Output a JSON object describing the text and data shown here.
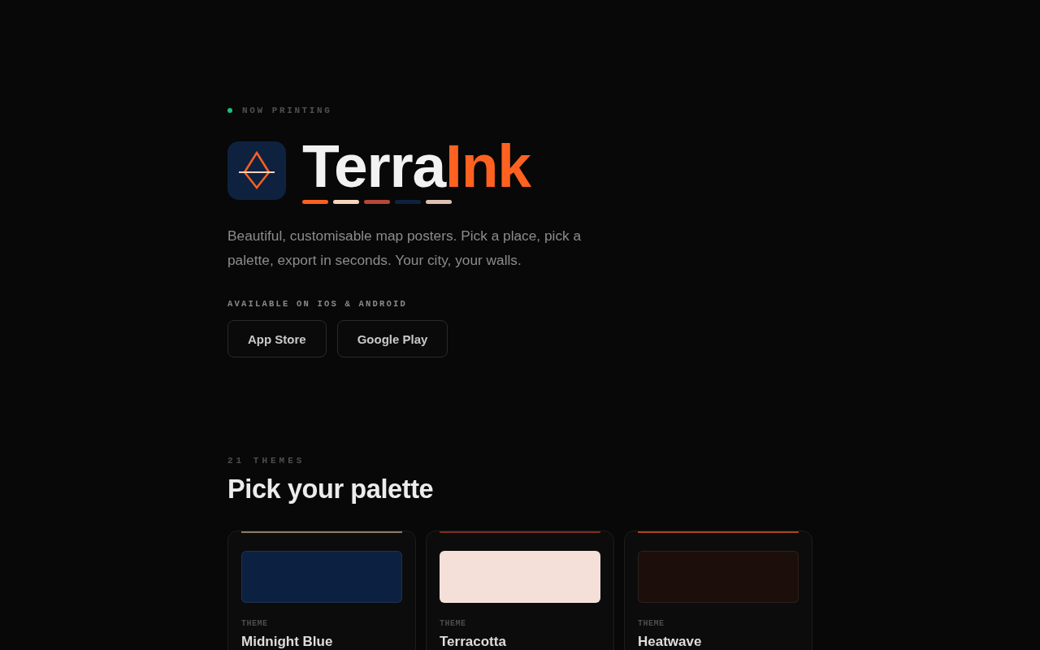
{
  "hero": {
    "status": {
      "label": "NOW PRINTING"
    },
    "title": {
      "parts": [
        {
          "text": "Terra",
          "kind": "base"
        },
        {
          "text": "Ink",
          "kind": "accent"
        }
      ]
    },
    "palette": [
      {
        "color": "#ff5f1f"
      },
      {
        "color": "#f7d7bc"
      },
      {
        "color": "#b5473a"
      },
      {
        "color": "#0e2240"
      },
      {
        "color": "#dfc0b2"
      }
    ],
    "description": "Beautiful, customisable map posters. Pick a place, pick a palette, export in seconds. Your city, your walls.",
    "availability": "AVAILABLE ON IOS & ANDROID",
    "buttons": [
      "App Store",
      "Google Play"
    ]
  },
  "themes": {
    "count": "21 THEMES",
    "heading": "Pick your palette",
    "cards": [
      {
        "label": "THEME",
        "name": "Midnight Blue",
        "accent": {
          "color": "#8b7b68"
        },
        "swatch": {
          "color": "#0c2042"
        }
      },
      {
        "label": "THEME",
        "name": "Terracotta",
        "accent": {
          "color": "#7a2d22"
        },
        "swatch": {
          "color": "#f5e0d9"
        }
      },
      {
        "label": "THEME",
        "name": "Heatwave",
        "accent": {
          "color": "#a8441a"
        },
        "swatch": {
          "color": "#1c0f0b"
        }
      }
    ]
  }
}
